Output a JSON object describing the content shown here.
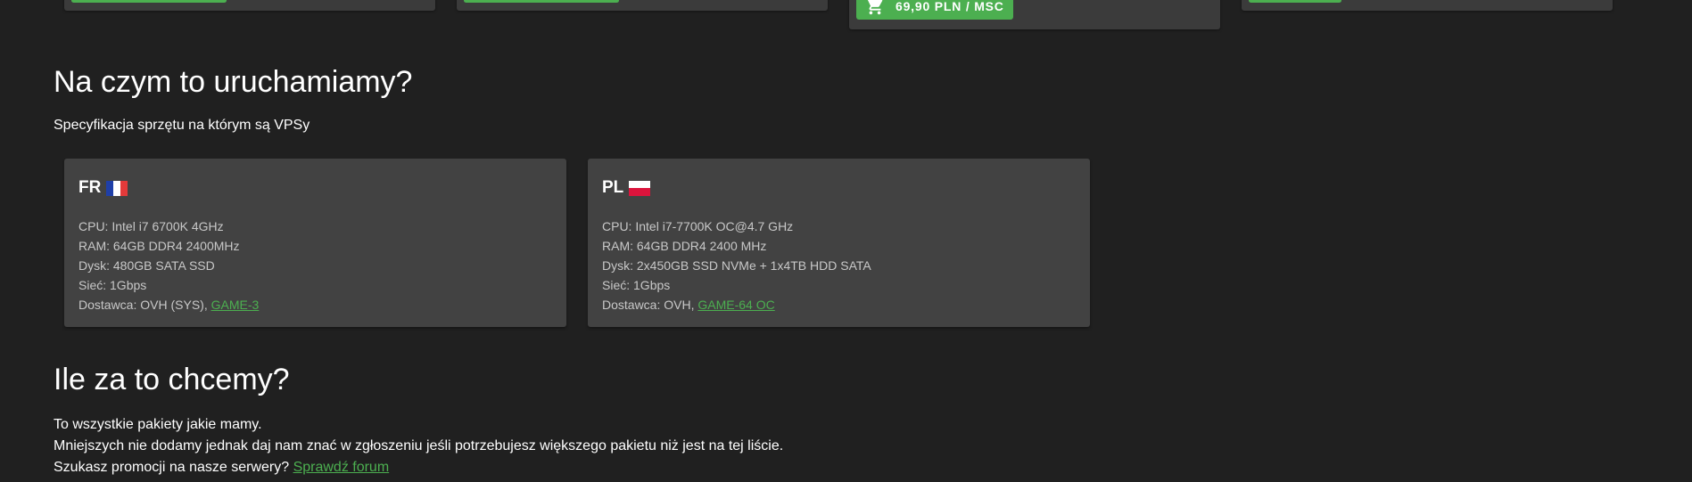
{
  "pricing": {
    "featured_price_label": "69,90 PLN / MSC"
  },
  "hardware": {
    "title": "Na czym to uruchamiamy?",
    "subtitle": "Specyfikacja sprzętu na którym są VPSy",
    "servers": [
      {
        "code": "FR",
        "flag_icon": "flag-france-icon",
        "flag_colors": [
          "#1f3fa8",
          "#ffffff",
          "#e33a3a"
        ],
        "cpu": "CPU: Intel i7 6700K 4GHz",
        "ram": "RAM: 64GB DDR4 2400MHz",
        "disk": "Dysk: 480GB SATA SSD",
        "network": "Sieć: 1Gbps",
        "provider_prefix": "Dostawca: OVH (SYS), ",
        "provider_link": "GAME-3"
      },
      {
        "code": "PL",
        "flag_icon": "flag-poland-icon",
        "flag_colors": [
          "#ffffff",
          "#dc143c"
        ],
        "cpu": "CPU: Intel i7-7700K OC@4.7 GHz",
        "ram": "RAM: 64GB DDR4 2400 MHz",
        "disk": "Dysk: 2x450GB SSD NVMe + 1x4TB HDD SATA",
        "network": "Sieć: 1Gbps",
        "provider_prefix": "Dostawca: OVH, ",
        "provider_link": "GAME-64 OC"
      }
    ]
  },
  "pricing_section": {
    "title": "Ile za to chcemy?",
    "line1": "To wszystkie pakiety jakie mamy.",
    "line2": "Mniejszych nie dodamy jednak daj nam znać w zgłoszeniu jeśli potrzebujesz większego pakietu niż jest na tej liście.",
    "line3_prefix": "Szukasz promocji na nasze serwery? ",
    "line3_link": "Sprawdź forum"
  },
  "colors": {
    "accent": "#4caf50",
    "background": "#202020",
    "card": "#424242"
  }
}
